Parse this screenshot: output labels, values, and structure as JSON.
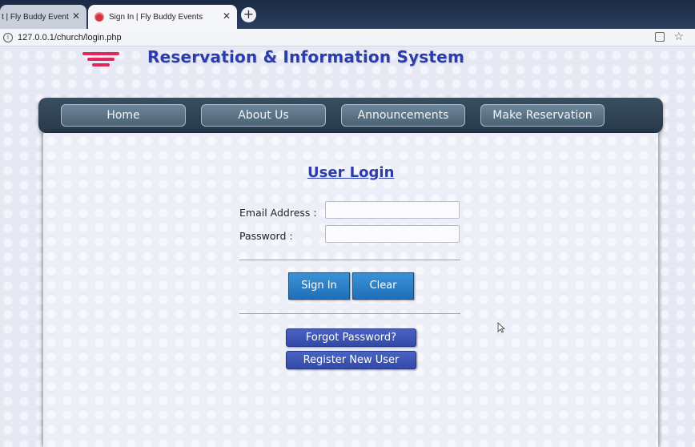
{
  "browser": {
    "tabs": [
      {
        "label": "t | Fly Buddy Event"
      },
      {
        "label": "Sign In | Fly Buddy Events"
      }
    ],
    "new_tab_label": "+",
    "url": "127.0.0.1/church/login.php"
  },
  "site": {
    "title": "Reservation & Information System"
  },
  "nav": {
    "items": [
      {
        "label": "Home"
      },
      {
        "label": "About Us"
      },
      {
        "label": "Announcements"
      },
      {
        "label": "Make Reservation"
      }
    ]
  },
  "login": {
    "title": "User Login",
    "email_label": "Email Address :",
    "password_label": "Password :",
    "email_value": "",
    "password_value": "",
    "sign_in_label": "Sign In",
    "clear_label": "Clear",
    "forgot_label": "Forgot Password?",
    "register_label": "Register New User"
  },
  "colors": {
    "accent": "#2b3dad",
    "logo": "#e0295a",
    "nav_bg": "#26394b",
    "button": "#1f6fb8"
  }
}
